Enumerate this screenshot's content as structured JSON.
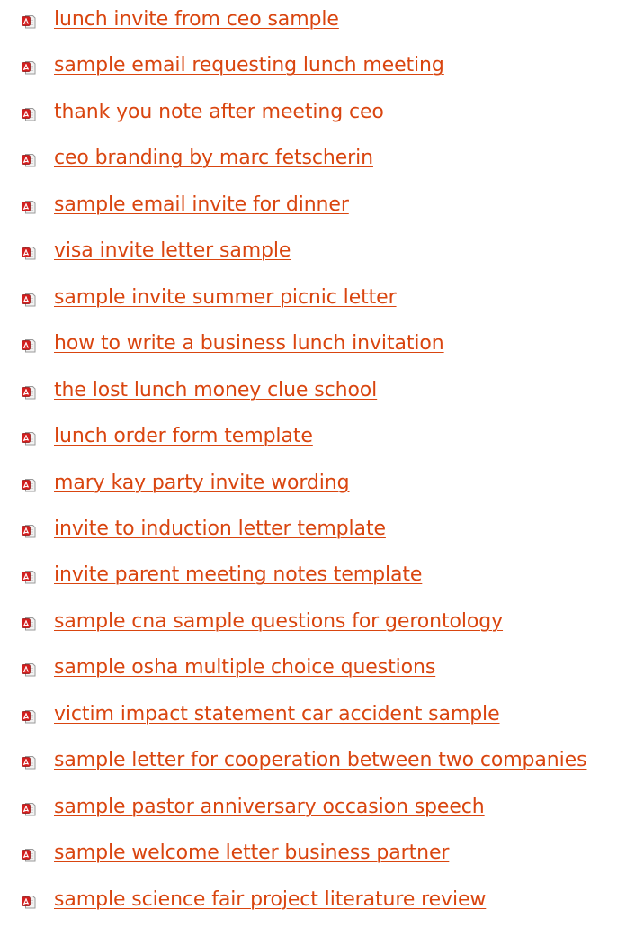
{
  "links": [
    {
      "label": "lunch invite from ceo sample",
      "icon": "pdf-file-icon"
    },
    {
      "label": "sample email requesting lunch meeting",
      "icon": "pdf-file-icon"
    },
    {
      "label": "thank you note after meeting ceo",
      "icon": "pdf-file-icon"
    },
    {
      "label": "ceo branding by marc fetscherin",
      "icon": "pdf-file-icon"
    },
    {
      "label": "sample email invite for dinner",
      "icon": "pdf-file-icon"
    },
    {
      "label": "visa invite letter sample",
      "icon": "pdf-file-icon"
    },
    {
      "label": "sample invite summer picnic letter",
      "icon": "pdf-file-icon"
    },
    {
      "label": "how to write a business lunch invitation",
      "icon": "pdf-file-icon"
    },
    {
      "label": "the lost lunch money clue school",
      "icon": "pdf-file-icon"
    },
    {
      "label": "lunch order form template",
      "icon": "pdf-file-icon"
    },
    {
      "label": "mary kay party invite wording",
      "icon": "pdf-file-icon"
    },
    {
      "label": "invite to induction letter template",
      "icon": "pdf-file-icon"
    },
    {
      "label": "invite parent meeting notes template",
      "icon": "pdf-file-icon"
    },
    {
      "label": "sample cna sample questions for gerontology",
      "icon": "pdf-file-icon"
    },
    {
      "label": "sample osha multiple choice questions",
      "icon": "pdf-file-icon"
    },
    {
      "label": "victim impact statement car accident sample",
      "icon": "pdf-file-icon"
    },
    {
      "label": "sample letter for cooperation between two companies",
      "icon": "pdf-file-icon"
    },
    {
      "label": "sample pastor anniversary occasion speech",
      "icon": "pdf-file-icon"
    },
    {
      "label": "sample welcome letter business partner",
      "icon": "pdf-file-icon"
    },
    {
      "label": "sample science fair project literature review",
      "icon": "pdf-file-icon"
    }
  ],
  "colors": {
    "link": "#d9450f",
    "icon_red": "#d21f1f",
    "icon_page": "#ececec"
  }
}
